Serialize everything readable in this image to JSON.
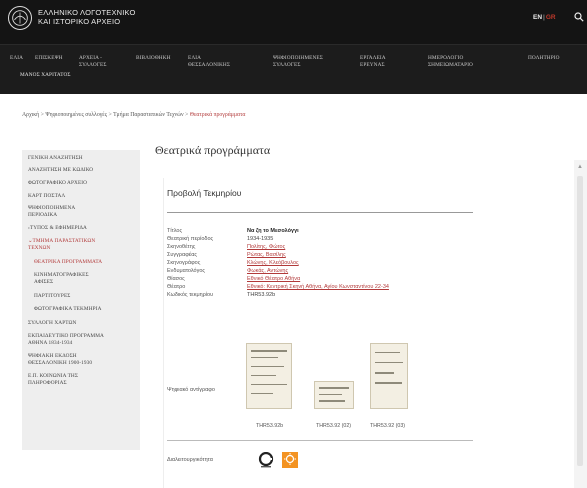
{
  "header": {
    "brand_line1": "ΕΛΛΗΝΙΚΟ ΛΟΓΟΤΕΧΝΙΚΟ",
    "brand_line2": "ΚΑΙ ΙΣΤΟΡΙΚΟ ΑΡΧΕΙΟ",
    "lang_en": "EN",
    "lang_sep": "|",
    "lang_gr": "GR"
  },
  "nav": {
    "items": [
      {
        "line1": "ΕΛΙΑ",
        "line2": ""
      },
      {
        "line1": "ΕΠΙΣΚΕΨΗ",
        "line2": ""
      },
      {
        "line1": "ΑΡΧΕΙΑ -",
        "line2": "ΣΥΛΛΟΓΕΣ"
      },
      {
        "line1": "ΒΙΒΛΙΟΘΗΚΗ",
        "line2": ""
      },
      {
        "line1": "ΕΛΙΑ",
        "line2": "ΘΕΣΣΑΛΟΝΙΚΗΣ"
      },
      {
        "line1": "ΨΗΦΙΟΠΟΙΗΜΕΝΕΣ",
        "line2": "ΣΥΛΛΟΓΕΣ"
      },
      {
        "line1": "ΕΡΓΑΛΕΙΑ",
        "line2": "ΕΡΕΥΝΑΣ"
      },
      {
        "line1": "ΗΜΕΡΟΛΟΓΙΟ",
        "line2": "ΣΗΜΕΙΩΜΑΤΑΡΙΟ"
      },
      {
        "line1": "ΠΟΛΗΤΗΡΙΟ",
        "line2": ""
      }
    ],
    "second_row": "ΜΑΝΟΣ ΧΑΡΙΤΑΤΟΣ"
  },
  "breadcrumb": {
    "home": "Αρχική",
    "sep": ">",
    "level1": "Ψηφιοποιημένες συλλογές",
    "level2": "Τμήμα Παραστατικών Τεχνών",
    "current": "Θεατρικά προγράμματα"
  },
  "sidebar": {
    "items": [
      {
        "label": "ΓΕΝΙΚΗ ΑΝΑΖΗΤΗΣΗ"
      },
      {
        "label": "ΑΝΑΖΗΤΗΣΗ ΜΕ ΚΩΔΙΚΟ"
      },
      {
        "label": "ΦΩΤΟΓΡΑΦΙΚΟ ΑΡΧΕΙΟ"
      },
      {
        "label": "ΚΑΡΤ ΠΟΣΤΑΛ"
      },
      {
        "label": "ΨΗΦΙΟΠΟΙΗΜΕΝΑ",
        "label2": "ΠΕΡΙΟΔΙΚΑ"
      },
      {
        "label": "›ΤΥΠΟΣ & ΕΦΗΜΕΡΙΔΑ"
      },
      {
        "label": "⌄ΤΜΗΜΑ ΠΑΡΑΣΤΑΤΙΚΩΝ",
        "label2": "ΤΕΧΝΩΝ"
      },
      {
        "label": "ΘΕΑΤΡΙΚΑ ΠΡΟΓΡΑΜΜΑΤΑ"
      },
      {
        "label": "ΚΙΝΗΜΑΤΟΓΡΑΦΙΚΕΣ",
        "label2": "ΑΦΙΣΕΣ"
      },
      {
        "label": "ΠΑΡΤΙΤΟΥΡΕΣ"
      },
      {
        "label": "ΦΩΤΟΓΡΑΦΙΚΑ ΤΕΚΜΗΡΙΑ"
      },
      {
        "label": "ΣΥΛΛΟΓΗ ΧΑΡΤΩΝ"
      },
      {
        "label": "ΕΚΠΑΙΔΕΥΤΙΚΟ ΠΡΟΓΡΑΜΜΑ",
        "label2": "ΑΘΗΝΑ 1834-1934"
      },
      {
        "label": "ΨΗΦΙΑΚΗ ΕΚΔΟΣΗ",
        "label2": "ΘΕΣΣΑΛΟΝΙΚΗ 1900-1930"
      },
      {
        "label": "Ε.Π. ΚΟΙΝΩΝΙΑ ΤΗΣ",
        "label2": "ΠΛΗΡΟΦΟΡΙΑΣ"
      }
    ]
  },
  "main": {
    "title": "Θεατρικά προγράμματα",
    "subtitle": "Προβολή Τεκμηρίου",
    "fields": [
      {
        "label": "Τίτλος",
        "value": "Να ζη το Μεσολόγγι"
      },
      {
        "label": "Θεατρική περίοδος",
        "value": "1934-1935"
      },
      {
        "label": "Σκηνοθέτης",
        "value": "Πολίτης, Φώτος"
      },
      {
        "label": "Συγγραφέας",
        "value": "Ρώτας, Βασίλης"
      },
      {
        "label": "Σκηνογράφος",
        "value": "Κλώνης, Κλεόβουλος"
      },
      {
        "label": "Ενδυματολόγος",
        "value": "Φωκάς, Αντώνης"
      },
      {
        "label": "Θίασος",
        "value": "Εθνικό Θέατρο Αθήνα"
      },
      {
        "label": "Θέατρο",
        "value": "Εθνικό: Κεντρική Σκηνή Αθήνα, Αγίου Κωνσταντίνου 22-34"
      },
      {
        "label": "Κωδικός τεκμηρίου",
        "value": "THR53.92b"
      }
    ],
    "digital_label": "Ψηφιακό αντίγραφο",
    "thumbs": [
      {
        "caption": "THR53.92b"
      },
      {
        "caption": "THR53.92 (02)"
      },
      {
        "caption": "THR53.92 (03)"
      }
    ],
    "license_label": "Διαλειτουργικότητα"
  },
  "colors": {
    "header_bg": "#141414",
    "accent_red": "#b23a3a",
    "sidebar_bg": "#eeeeee",
    "oa_orange": "#f39322"
  }
}
